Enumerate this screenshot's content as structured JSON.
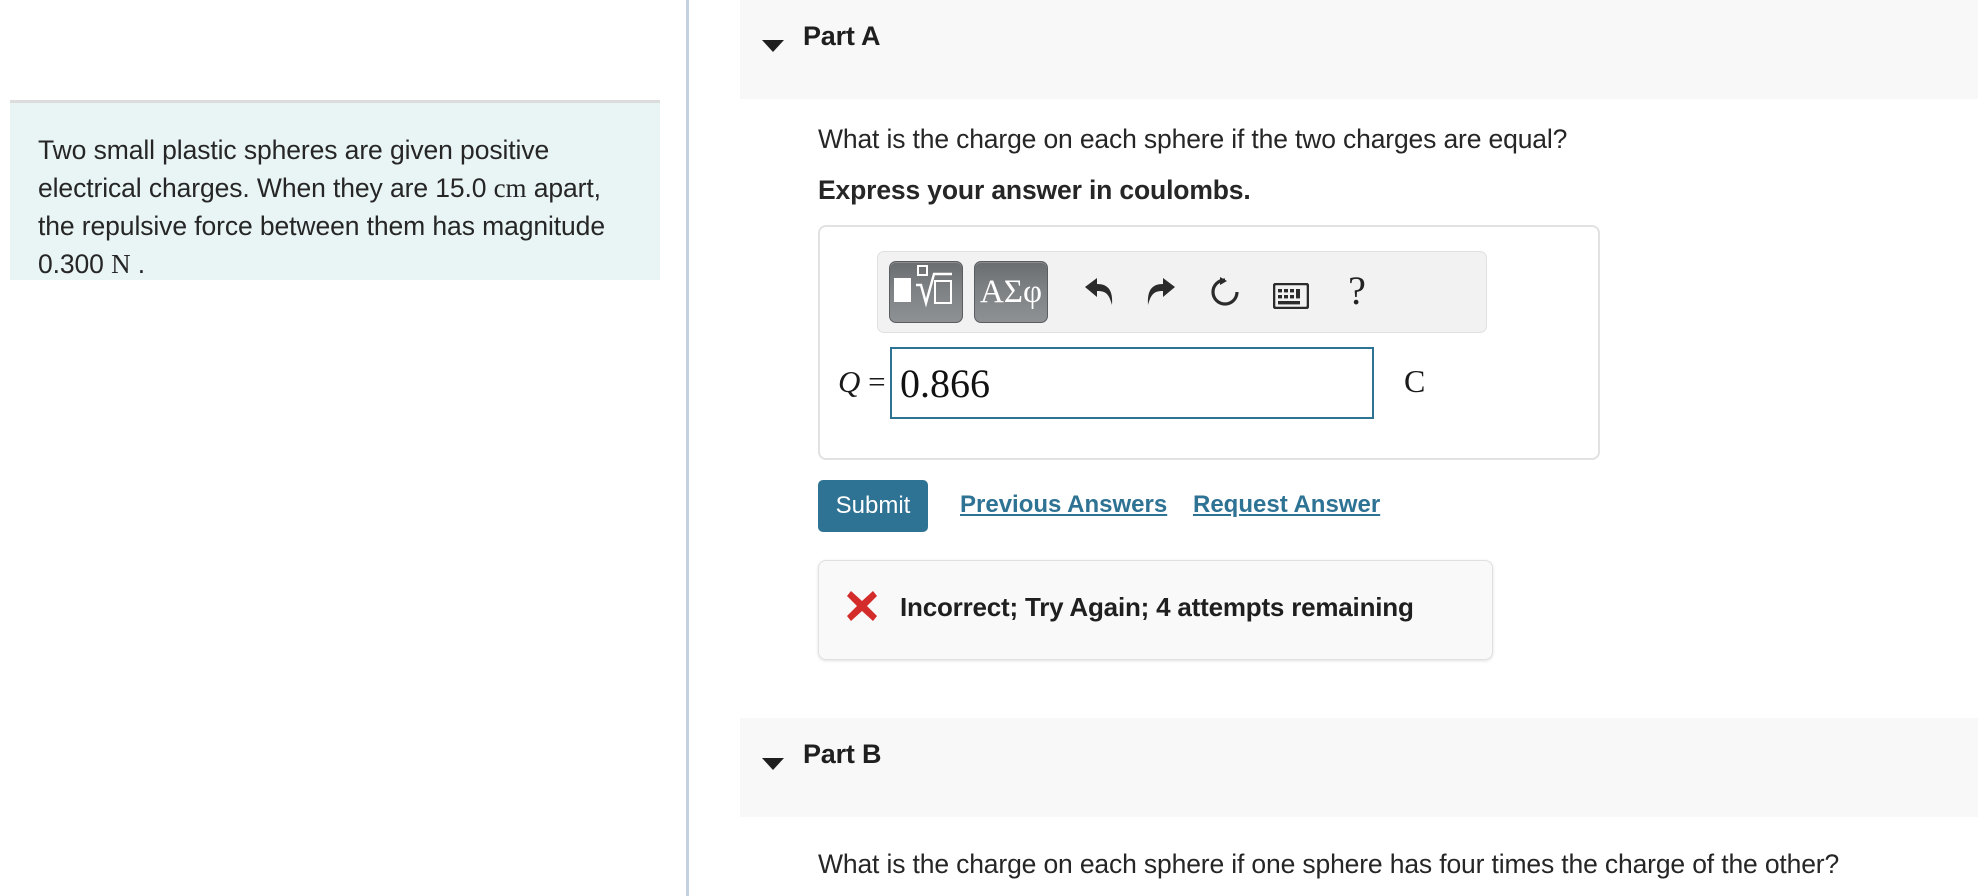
{
  "left_pane": {
    "problem_statement": {
      "line1": "Two small plastic spheres are given positive",
      "line2a": "electrical charges. When they are 15.0 ",
      "unit_cm": "cm",
      "line2b": " apart,",
      "line3": "the repulsive force between them has magnitude",
      "line4a": "0.300 ",
      "unit_N": "N",
      "line4b": " ."
    }
  },
  "part_a": {
    "title": "Part A",
    "question": "What is the charge on each sphere if the two charges are equal?",
    "instruction": "Express your answer in coulombs.",
    "answer": {
      "label_variable": "Q",
      "label_equals": "=",
      "value": "0.866",
      "unit": "C"
    },
    "toolbar": {
      "math_template_label": "math-template",
      "greek_label": "ΑΣφ",
      "undo_label": "undo",
      "redo_label": "redo",
      "reset_label": "reset",
      "keyboard_label": "keyboard",
      "help_label": "?"
    },
    "actions": {
      "submit_label": "Submit",
      "previous_answers_label": "Previous Answers",
      "request_answer_label": "Request Answer"
    },
    "feedback": {
      "icon": "x-mark-icon",
      "message": "Incorrect; Try Again; 4 attempts remaining"
    }
  },
  "part_b": {
    "title": "Part B",
    "question": "What is the charge on each sphere if one sphere has four times the charge of the other?"
  },
  "colors": {
    "accent_teal": "#2e7294",
    "problem_box_bg": "#e9f4f5",
    "header_bg": "#f8f8f8",
    "divider": "#c3d2de",
    "error_red": "#d42b2b"
  }
}
